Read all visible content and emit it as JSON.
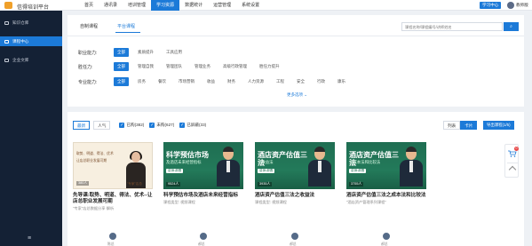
{
  "header": {
    "app_title": "信得培训平台",
    "nav": [
      "首页",
      "通讯录",
      "培训管理",
      "学习资源",
      "数据统计",
      "运营管理",
      "系统设置"
    ],
    "active_nav": 3,
    "center_button": "学习中心",
    "user_name": "教师版"
  },
  "sidebar": {
    "items": [
      {
        "label": "知识仓库",
        "icon": "folder-icon"
      },
      {
        "label": "课程中心",
        "icon": "book-icon"
      },
      {
        "label": "企业文库",
        "icon": "document-icon"
      }
    ],
    "active_index": 1,
    "collapse_icon": "menu-icon"
  },
  "tabs": {
    "items": [
      "自制课程",
      "平台课程"
    ],
    "active_index": 1
  },
  "search": {
    "placeholder": "课程名称/课程编号/讲师姓名",
    "button_icon": "search-icon"
  },
  "filters": [
    {
      "label": "职业能力:",
      "options": [
        "全部",
        "素质提升",
        "工具应用"
      ]
    },
    {
      "label": "胜任力:",
      "options": [
        "全部",
        "管理自我",
        "管理团队",
        "管理业务",
        "高级行政管理",
        "胜任力提升"
      ]
    },
    {
      "label": "专业能力:",
      "options": [
        "全部",
        "房务",
        "餐饮",
        "市场营销",
        "收益",
        "财务",
        "人力资源",
        "工程",
        "安全",
        "行政",
        "康乐"
      ]
    }
  ],
  "more_label": "更多选项 ⌄",
  "toolbar": {
    "sort_options": [
      "最新",
      "人气"
    ],
    "sort_active": 0,
    "checks": [
      "已购(382)",
      "未购(627)",
      "已屏蔽(33)"
    ],
    "view_options": [
      "列表",
      "卡片"
    ],
    "view_active": 1,
    "export_label": "导出课程(1/5)"
  },
  "cards": [
    {
      "title": "先导课:取势、明道、得法、优术--让店总职业发展可期",
      "meta": "\"专家\"店总数据分享·解析",
      "views": "380人",
      "author": "陈总",
      "thumb_lines": [
        "取势、明道、得法、优术",
        "让店总职业发展可期"
      ],
      "thumb_badge": "\"专家\"店总"
    },
    {
      "title": "科学预估市场及酒店未来经营指标",
      "meta": "课程类型: 视频课程",
      "views": "9524人",
      "author": "郝总",
      "headline": "科学预估市场",
      "subhead": "及酒店未来经营指标",
      "tag": "讲师:郝晋"
    },
    {
      "title": "酒店资产估值三法之收益法",
      "meta": "课程类型: 视频课程",
      "views": "3935人",
      "author": "郝总",
      "headline": "酒店资产估值三法",
      "subhead": "之收益法",
      "tag": "讲师:郝晋"
    },
    {
      "title": "酒店资产估值三法之成本法和比较法",
      "meta": "\"酒店资产管理系列课程\"",
      "views": "3755人",
      "author": "郝总",
      "headline": "酒店资产估值三法",
      "subhead": "之成本法和比较法",
      "tag": "讲师:郝晋"
    }
  ],
  "float": {
    "cart_count": "0",
    "cart_icon": "cart-icon",
    "top_icon": "arrow-up-icon"
  },
  "colors": {
    "accent": "#1c7ad8",
    "sidebar_bg": "#142135",
    "thumb_green": "#1f6e52"
  }
}
